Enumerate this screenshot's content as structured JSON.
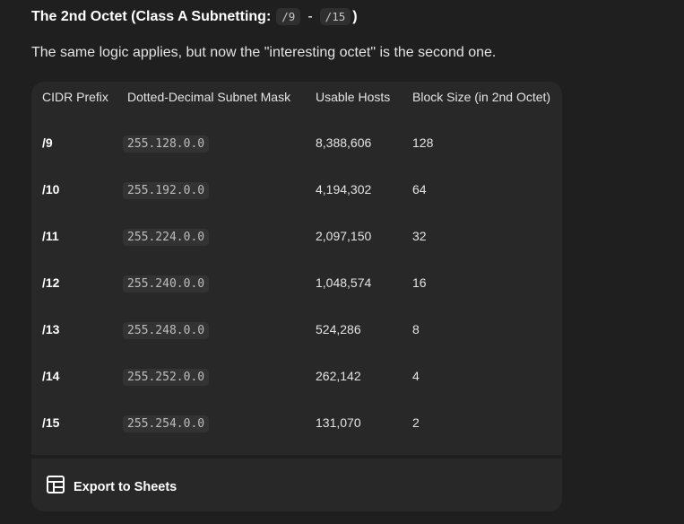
{
  "heading": {
    "text": "The 2nd Octet (Class A Subnetting:",
    "code_start": "/9",
    "separator": "-",
    "code_end": "/15",
    "close": ")"
  },
  "intro": "The same logic applies, but now the \"interesting octet\" is the second one.",
  "table": {
    "headers": [
      "CIDR Prefix",
      "Dotted-Decimal Subnet Mask",
      "Usable Hosts",
      "Block Size (in 2nd Octet)"
    ],
    "rows": [
      {
        "prefix": "/9",
        "mask": "255.128.0.0",
        "hosts": "8,388,606",
        "block": "128"
      },
      {
        "prefix": "/10",
        "mask": "255.192.0.0",
        "hosts": "4,194,302",
        "block": "64"
      },
      {
        "prefix": "/11",
        "mask": "255.224.0.0",
        "hosts": "2,097,150",
        "block": "32"
      },
      {
        "prefix": "/12",
        "mask": "255.240.0.0",
        "hosts": "1,048,574",
        "block": "16"
      },
      {
        "prefix": "/13",
        "mask": "255.248.0.0",
        "hosts": "524,286",
        "block": "8"
      },
      {
        "prefix": "/14",
        "mask": "255.252.0.0",
        "hosts": "262,142",
        "block": "4"
      },
      {
        "prefix": "/15",
        "mask": "255.254.0.0",
        "hosts": "131,070",
        "block": "2"
      }
    ]
  },
  "export": {
    "icon": "table-icon",
    "label": "Export to Sheets"
  },
  "colors": {
    "background": "#1f1f1f",
    "card": "#282828",
    "code_chip": "#2f2f2f",
    "text": "#e3e3e3"
  }
}
